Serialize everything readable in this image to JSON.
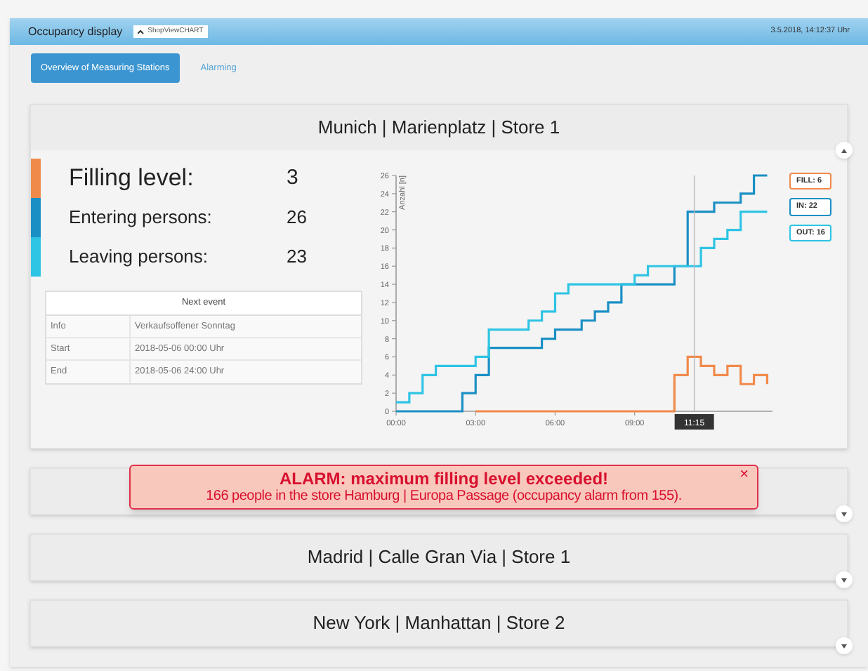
{
  "header": {
    "title": "Occupancy display",
    "badge": "ShopViewCHART",
    "datetime": "3.5.2018, 14:12:37 Uhr"
  },
  "tabs": [
    {
      "label": "Overview of Measuring Stations",
      "selected": true
    },
    {
      "label": "Alarming",
      "selected": false
    }
  ],
  "stores": [
    {
      "title": "Munich | Marienplatz | Store 1",
      "expanded": true,
      "stats": [
        {
          "label": "Filling level:",
          "value": "3",
          "color": "#f08a4b",
          "kind": "primary"
        },
        {
          "label": "Entering persons:",
          "value": "26",
          "color": "#1a8fc4",
          "kind": "secondary"
        },
        {
          "label": "Leaving persons:",
          "value": "23",
          "color": "#2ec4e4",
          "kind": "secondary"
        }
      ],
      "next_event": {
        "heading": "Next event",
        "rows": [
          {
            "key": "Info",
            "value": "Verkaufsoffener Sonntag"
          },
          {
            "key": "Start",
            "value": "2018-05-06 00:00 Uhr"
          },
          {
            "key": "End",
            "value": "2018-05-06 24:00 Uhr"
          }
        ]
      },
      "chart_data": {
        "type": "line",
        "ylabel": "Anzahl [n]",
        "xlim": [
          0,
          14.2
        ],
        "ylim": [
          0,
          26
        ],
        "x": [
          0,
          0.5,
          0.5,
          1,
          1,
          1.5,
          1.5,
          2,
          2,
          2.5,
          2.5,
          3,
          3,
          3.5,
          3.5,
          4,
          4,
          4.5,
          4.5,
          5,
          5,
          5.5,
          5.5,
          6,
          6,
          6.5,
          6.5,
          7,
          7,
          7.5,
          7.5,
          8,
          8,
          8.5,
          8.5,
          9,
          9,
          9.5,
          9.5,
          10,
          10,
          10.5,
          10.5,
          11,
          11,
          11.5,
          11.5,
          12,
          12,
          12.5,
          12.5,
          13,
          13,
          13.5,
          13.5,
          14,
          14
        ],
        "series": [
          {
            "name": "FILL: 6",
            "color": "#f08a4b",
            "values": [
              null,
              null,
              null,
              null,
              null,
              null,
              null,
              null,
              null,
              null,
              null,
              null,
              0,
              0,
              0,
              0,
              0,
              0,
              0,
              0,
              0,
              0,
              0,
              0,
              0,
              0,
              0,
              0,
              0,
              0,
              0,
              0,
              0,
              0,
              0,
              0,
              0,
              0,
              0,
              0,
              0,
              0,
              4,
              4,
              6,
              6,
              5,
              5,
              4,
              4,
              5,
              5,
              3,
              3,
              4,
              4,
              3
            ]
          },
          {
            "name": "IN: 22",
            "color": "#1a8fc4",
            "values": [
              0,
              0,
              0,
              0,
              0,
              0,
              0,
              0,
              0,
              0,
              2,
              2,
              4,
              4,
              7,
              7,
              7,
              7,
              7,
              7,
              7,
              7,
              8,
              8,
              9,
              9,
              9,
              9,
              10,
              10,
              11,
              11,
              12,
              12,
              14,
              14,
              14,
              14,
              14,
              14,
              14,
              14,
              16,
              16,
              22,
              22,
              22,
              22,
              23,
              23,
              23,
              23,
              24,
              24,
              26,
              26,
              26
            ]
          },
          {
            "name": "OUT: 16",
            "color": "#2ec4e4",
            "values": [
              1,
              1,
              2,
              2,
              4,
              4,
              5,
              5,
              5,
              5,
              5,
              5,
              6,
              6,
              9,
              9,
              9,
              9,
              9,
              9,
              10,
              10,
              11,
              11,
              13,
              13,
              14,
              14,
              14,
              14,
              14,
              14,
              14,
              14,
              14,
              14,
              15,
              15,
              16,
              16,
              16,
              16,
              16,
              16,
              16,
              16,
              18,
              18,
              19,
              19,
              20,
              20,
              22,
              22,
              22,
              22,
              22
            ]
          }
        ],
        "xticks": [
          {
            "value": 0,
            "label": "00:00"
          },
          {
            "value": 3,
            "label": "03:00"
          },
          {
            "value": 6,
            "label": "06:00"
          },
          {
            "value": 9,
            "label": "09:00"
          }
        ],
        "yticks": [
          0,
          2,
          4,
          6,
          8,
          10,
          12,
          14,
          16,
          18,
          20,
          22,
          24,
          26
        ],
        "ref_lines": [
          {
            "axis": "x",
            "value": 11.25,
            "label": "11:15"
          }
        ]
      }
    },
    {
      "expanded": false
    },
    {
      "title": "Madrid | Calle Gran Via | Store 1",
      "expanded": false
    },
    {
      "title": "New York | Manhattan | Store 2",
      "expanded": false
    }
  ],
  "alarm": {
    "title": "ALARM: maximum filling level exceeded!",
    "message": "166 people in the store Hamburg | Europa Passage (occupancy alarm from 155).",
    "close": "×"
  }
}
